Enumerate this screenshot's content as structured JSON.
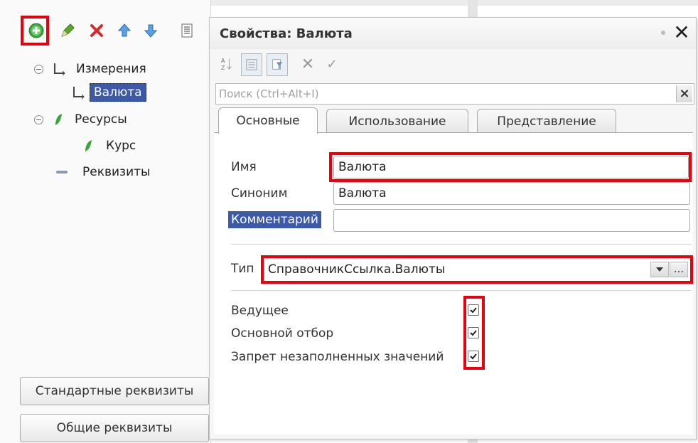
{
  "left": {
    "toolbar": [
      "add-icon",
      "edit-icon",
      "delete-icon",
      "move-up-icon",
      "move-down-icon",
      "list-icon"
    ],
    "tree": {
      "dimensions": "Измерения",
      "dimension_child": "Валюта",
      "resources": "Ресурсы",
      "resource_child": "Курс",
      "attributes": "Реквизиты"
    },
    "buttons": {
      "standard_attributes": "Стандартные реквизиты",
      "common_attributes": "Общие реквизиты"
    }
  },
  "props": {
    "title": "Свойства: Валюта",
    "search_placeholder": "Поиск (Ctrl+Alt+I)",
    "tabs": [
      "Основные",
      "Использование",
      "Представление"
    ],
    "fields": {
      "name_label": "Имя",
      "name_value": "Валюта",
      "synonym_label": "Синоним",
      "synonym_value": "Валюта",
      "comment_label": "Комментарий",
      "comment_value": "",
      "type_label": "Тип",
      "type_value": "СправочникСсылка.Валюты",
      "type_more": "..."
    },
    "checkboxes": [
      {
        "label": "Ведущее",
        "checked": true
      },
      {
        "label": "Основной отбор",
        "checked": true
      },
      {
        "label": "Запрет незаполненных значений",
        "checked": true
      }
    ]
  },
  "colors": {
    "highlight": "#e8000c",
    "selection": "#3d5aa8",
    "add_icon": "#3aa53a"
  }
}
